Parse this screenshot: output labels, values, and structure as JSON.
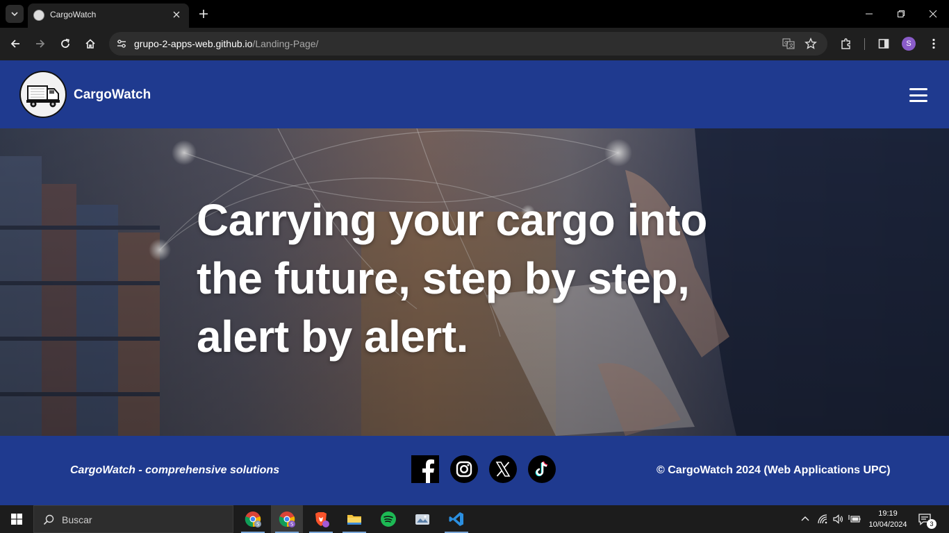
{
  "browser": {
    "tab": {
      "title": "CargoWatch"
    },
    "url": {
      "host": "grupo-2-apps-web.github.io",
      "path": "/Landing-Page/"
    },
    "profile_initial": "S"
  },
  "site": {
    "brand": "CargoWatch",
    "hero": {
      "line1": "Carrying your cargo into",
      "line2": "the future, step by step,",
      "line3": "alert by alert."
    },
    "footer": {
      "tagline": "CargoWatch - comprehensive solutions",
      "copyright": "© CargoWatch 2024 (Web Applications UPC)",
      "social": [
        "facebook-icon",
        "instagram-icon",
        "x-icon",
        "tiktok-icon"
      ]
    },
    "colors": {
      "brand_blue": "#1f3a8f",
      "white": "#ffffff"
    }
  },
  "taskbar": {
    "search_label": "Buscar",
    "time": "19:19",
    "date": "10/04/2024",
    "notification_count": "3",
    "apps": [
      "chrome-icon",
      "chrome-icon",
      "brave-icon",
      "file-explorer-icon",
      "spotify-icon",
      "photos-icon",
      "vscode-icon"
    ]
  }
}
